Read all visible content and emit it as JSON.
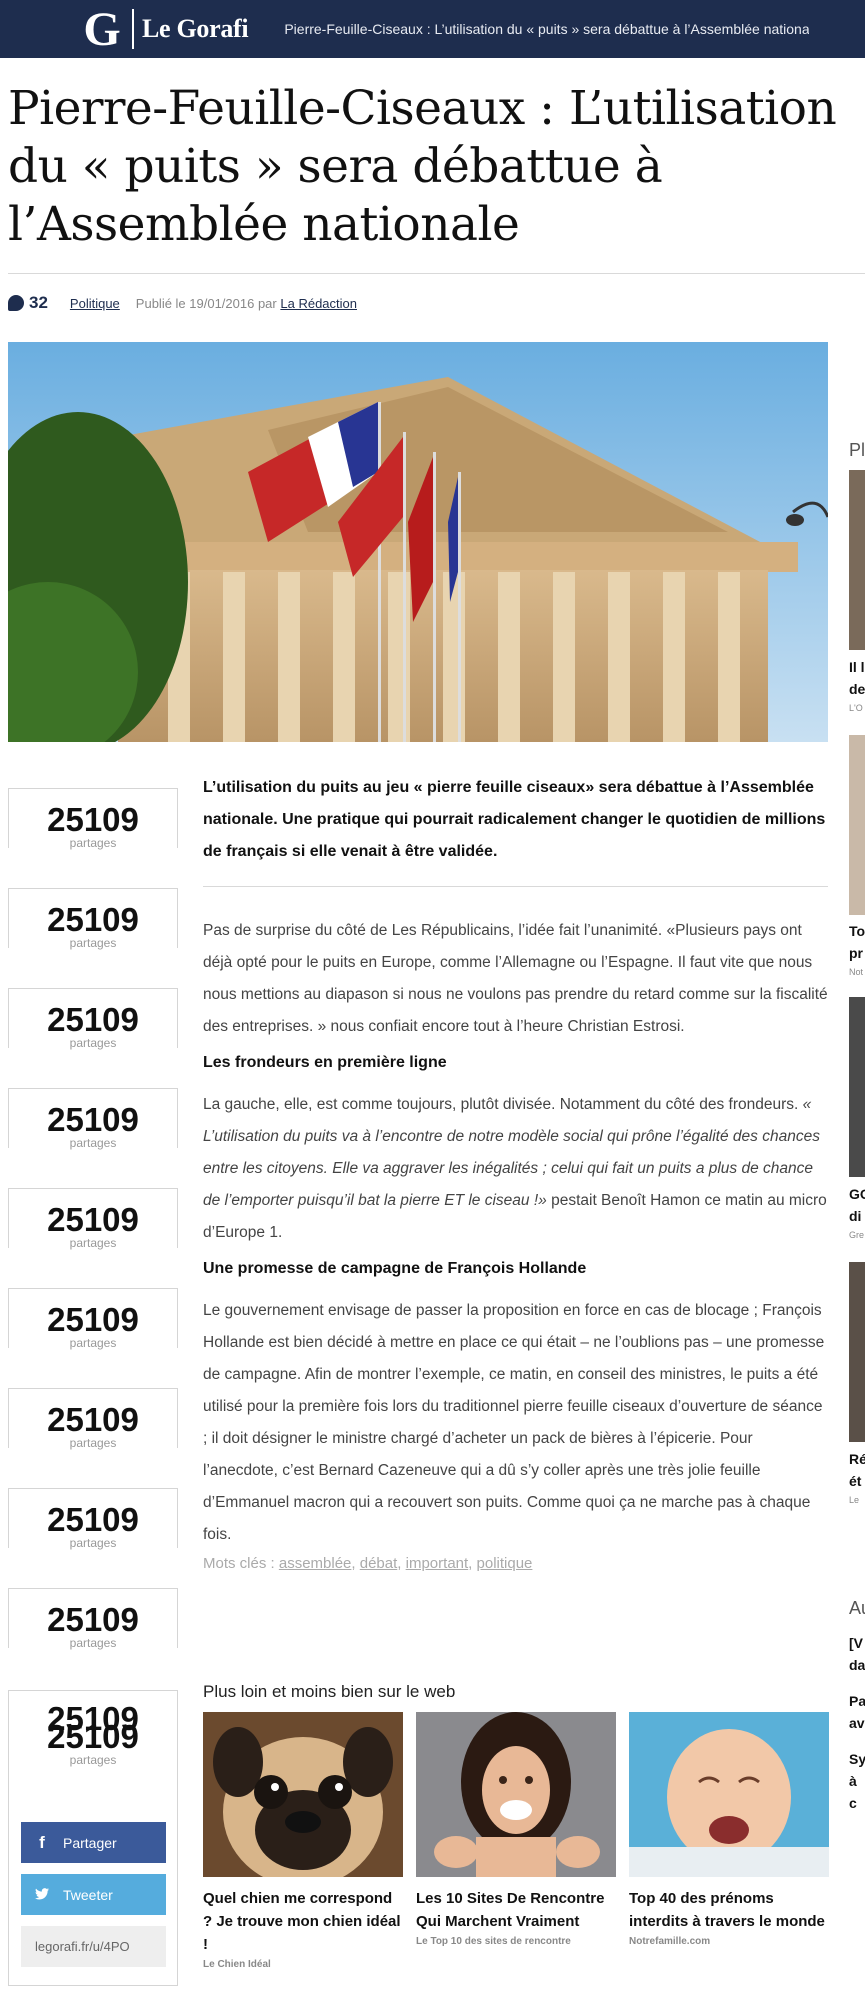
{
  "header": {
    "logo_mark": "G",
    "logo_text": "Le Gorafi",
    "title": "Pierre-Feuille-Ciseaux : L’utilisation du « puits » sera débattue à l’Assemblée nationale"
  },
  "article": {
    "headline": "Pierre-Feuille-Ciseaux : L’utilisation du « puits » sera débattue à l’Assemblée nationale",
    "comments": "32",
    "category": "Politique",
    "published_prefix": "Publié le 19/01/2016 par",
    "author": "La Rédaction",
    "lead": "L’utilisation du puits au jeu « pierre feuille ciseaux» sera débattue à l’Assemblée nationale. Une pratique qui pourrait radicalement changer le quotidien de millions de français si elle venait à être validée.",
    "p1": "Pas de surprise du côté de Les Républicains, l’idée fait l’unanimité. «Plusieurs pays ont déjà opté pour le puits en Europe, comme l’Allemagne ou l’Espagne. Il faut vite que nous nous mettions au diapason si nous ne voulons pas prendre du retard comme sur la fiscalité des entreprises. » nous confiait encore tout à l’heure Christian Estrosi.",
    "h1": "Les frondeurs en première ligne",
    "p2_a": "La gauche, elle, est comme toujours, plutôt divisée. Notamment du côté des frondeurs.",
    "p2_quote": "« L’utilisation du puits va à l’encontre de notre modèle social qui prône l’égalité des chances entre les citoyens. Elle va aggraver les inégalités ; celui qui fait un puits a plus de chance de l’emporter puisqu’il bat la pierre ET le ciseau !»",
    "p2_b": "pestait Benoît Hamon ce matin au micro d’Europe 1.",
    "h2": "Une promesse de campagne de François Hollande",
    "p3": "Le gouvernement envisage de passer la proposition en force en cas de blocage ; François Hollande est bien décidé à mettre en place ce qui était – ne l’oublions pas – une promesse de campagne. Afin de montrer l’exemple, ce matin, en conseil des ministres, le puits a été utilisé pour la première fois lors du traditionnel pierre feuille ciseaux d’ouverture de séance ; il doit désigner le ministre chargé d’acheter un pack de bières à l’épicerie. Pour l’anecdote, c’est Bernard Cazeneuve qui a dû s’y coller après une très jolie feuille d’Emmanuel macron qui a recouvert son puits. Comme quoi ça ne marche pas à chaque fois.",
    "tags_label": "Mots clés :",
    "tags": [
      "assemblée",
      "débat",
      "important",
      "politique"
    ]
  },
  "share": {
    "count": "25109",
    "label": "partages",
    "facebook": "Partager",
    "twitter": "Tweeter",
    "short_url": "legorafi.fr/u/4PO"
  },
  "recommended": {
    "title": "Plus loin et moins bien sur le web",
    "items": [
      {
        "caption": "Quel chien me correspond ? Je trouve mon chien idéal !",
        "source": "Le Chien Idéal"
      },
      {
        "caption": "Les 10 Sites De Rencontre Qui Marchent Vraiment",
        "source": "Le Top 10 des sites de rencontre"
      },
      {
        "caption": "Top 40 des prénoms interdits à travers le monde",
        "source": "Notrefamille.com"
      }
    ]
  },
  "sidebar": {
    "heading1": "Pl",
    "items": [
      {
        "title": "Il l de",
        "source": "L'O"
      },
      {
        "title": "To pr",
        "source": "Not"
      },
      {
        "title": "GO di",
        "source": "Gre"
      },
      {
        "title": "Ré ét",
        "source": "Le"
      }
    ],
    "heading2": "Au",
    "links": [
      "[V da",
      "Pa av",
      "Sy à c"
    ]
  },
  "colors": {
    "brand_navy": "#1e2d4e",
    "facebook": "#3b5a9a",
    "twitter": "#55acdd"
  }
}
